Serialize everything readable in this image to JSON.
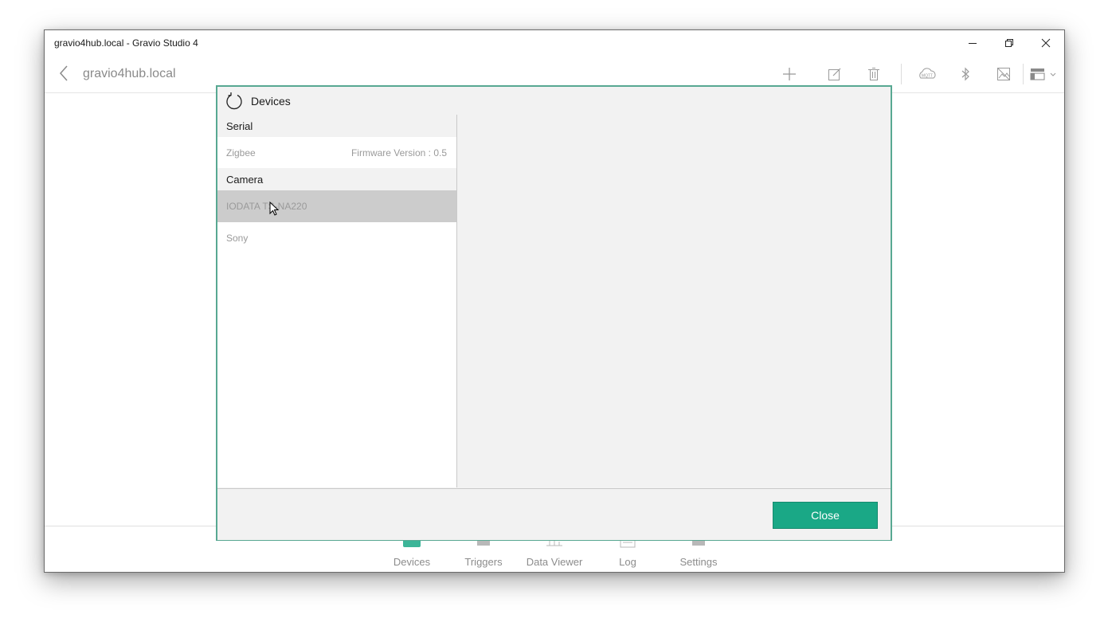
{
  "window": {
    "title": "gravio4hub.local - Gravio Studio 4",
    "controls": [
      "minimize-icon",
      "restore-icon",
      "close-icon"
    ]
  },
  "toolbar": {
    "hub_name": "gravio4hub.local",
    "icons": [
      "add-icon",
      "edit-icon",
      "delete-icon",
      "mqtt-icon",
      "bluetooth-icon",
      "image-off-icon",
      "layout-icon"
    ]
  },
  "bottom_nav": {
    "items": [
      {
        "label": "Devices",
        "icon": "devices-icon"
      },
      {
        "label": "Triggers",
        "icon": "triggers-icon"
      },
      {
        "label": "Data Viewer",
        "icon": "data-viewer-icon"
      },
      {
        "label": "Log",
        "icon": "log-icon"
      },
      {
        "label": "Settings",
        "icon": "settings-icon"
      }
    ],
    "active_color": "#1aa886"
  },
  "modal": {
    "title": "Devices",
    "groups": [
      {
        "name": "Serial",
        "items": [
          {
            "name": "Zigbee",
            "meta": "Firmware Version : 0.5"
          }
        ]
      },
      {
        "name": "Camera",
        "items": [
          {
            "name": "IODATA TS-NA220",
            "meta": "",
            "selected": true
          },
          {
            "name": "Sony",
            "meta": ""
          }
        ]
      }
    ],
    "close_label": "Close",
    "accent_color": "#1aa886",
    "border_color": "#58a892"
  }
}
